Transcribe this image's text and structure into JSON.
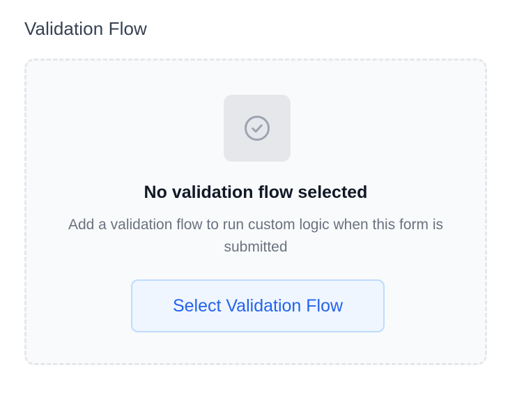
{
  "section": {
    "title": "Validation Flow"
  },
  "empty_state": {
    "icon": "check-circle-icon",
    "heading": "No validation flow selected",
    "description": "Add a validation flow to run custom logic when this form is submitted",
    "button_label": "Select Validation Flow"
  },
  "colors": {
    "accent": "#2563eb",
    "button_bg": "#eff6ff",
    "button_border": "#bfdbfe",
    "card_bg": "#f9fafb",
    "card_border": "#e5e7eb",
    "icon_tile_bg": "#e5e7eb",
    "icon_stroke": "#9ca3af"
  }
}
